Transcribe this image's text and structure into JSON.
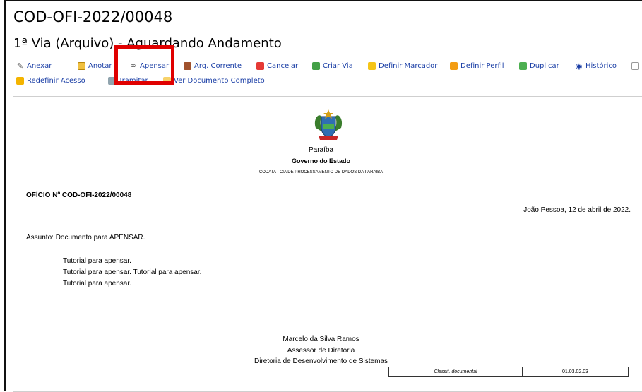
{
  "document": {
    "code": "COD-OFI-2022/00048",
    "status_line": "1ª Via (Arquivo) - Aguardando Andamento"
  },
  "toolbar": {
    "row1": [
      {
        "icon": "pencil-icon",
        "label": "Anexar"
      },
      {
        "icon": "note-icon",
        "label": "Anotar"
      },
      {
        "icon": "link-icon",
        "label": "Apensar"
      },
      {
        "icon": "archive-icon",
        "label": "Arq. Corrente"
      },
      {
        "icon": "cancel-icon",
        "label": "Cancelar"
      },
      {
        "icon": "add-icon",
        "label": "Criar Via"
      },
      {
        "icon": "bookmark-icon",
        "label": "Definir Marcador"
      },
      {
        "icon": "profile-icon",
        "label": "Definir Perfil"
      },
      {
        "icon": "duplicate-icon",
        "label": "Duplicar"
      },
      {
        "icon": "eye-icon",
        "label": "Histórico"
      }
    ],
    "row2": [
      {
        "icon": "shield-icon",
        "label": "Redefinir Acesso"
      },
      {
        "icon": "send-icon",
        "label": "Tramitar"
      },
      {
        "icon": "folder-icon",
        "label": "Ver Documento Completo"
      }
    ]
  },
  "letter": {
    "state": "Paraíba",
    "government": "Governo do Estado",
    "agency": "CODATA - CIA DE PROCESSAMENTO DE DADOS DA PARAIBA",
    "number": "OFÍCIO Nº COD-OFI-2022/00048",
    "place_date": "João Pessoa, 12 de abril de 2022.",
    "subject": "Assunto: Documento para APENSAR.",
    "body_lines": [
      "Tutorial para apensar.",
      "Tutorial para apensar. Tutorial para apensar.",
      "Tutorial para apensar."
    ],
    "signer_name": "Marcelo da Silva Ramos",
    "signer_role": "Assessor de Diretoria",
    "signer_dept": "Diretoria de Desenvolvimento de Sistemas",
    "classif_label": "Classif. documental",
    "classif_value": "01.03.02.03"
  },
  "colors": {
    "link": "#1b3fa6",
    "highlight": "#e00000"
  }
}
